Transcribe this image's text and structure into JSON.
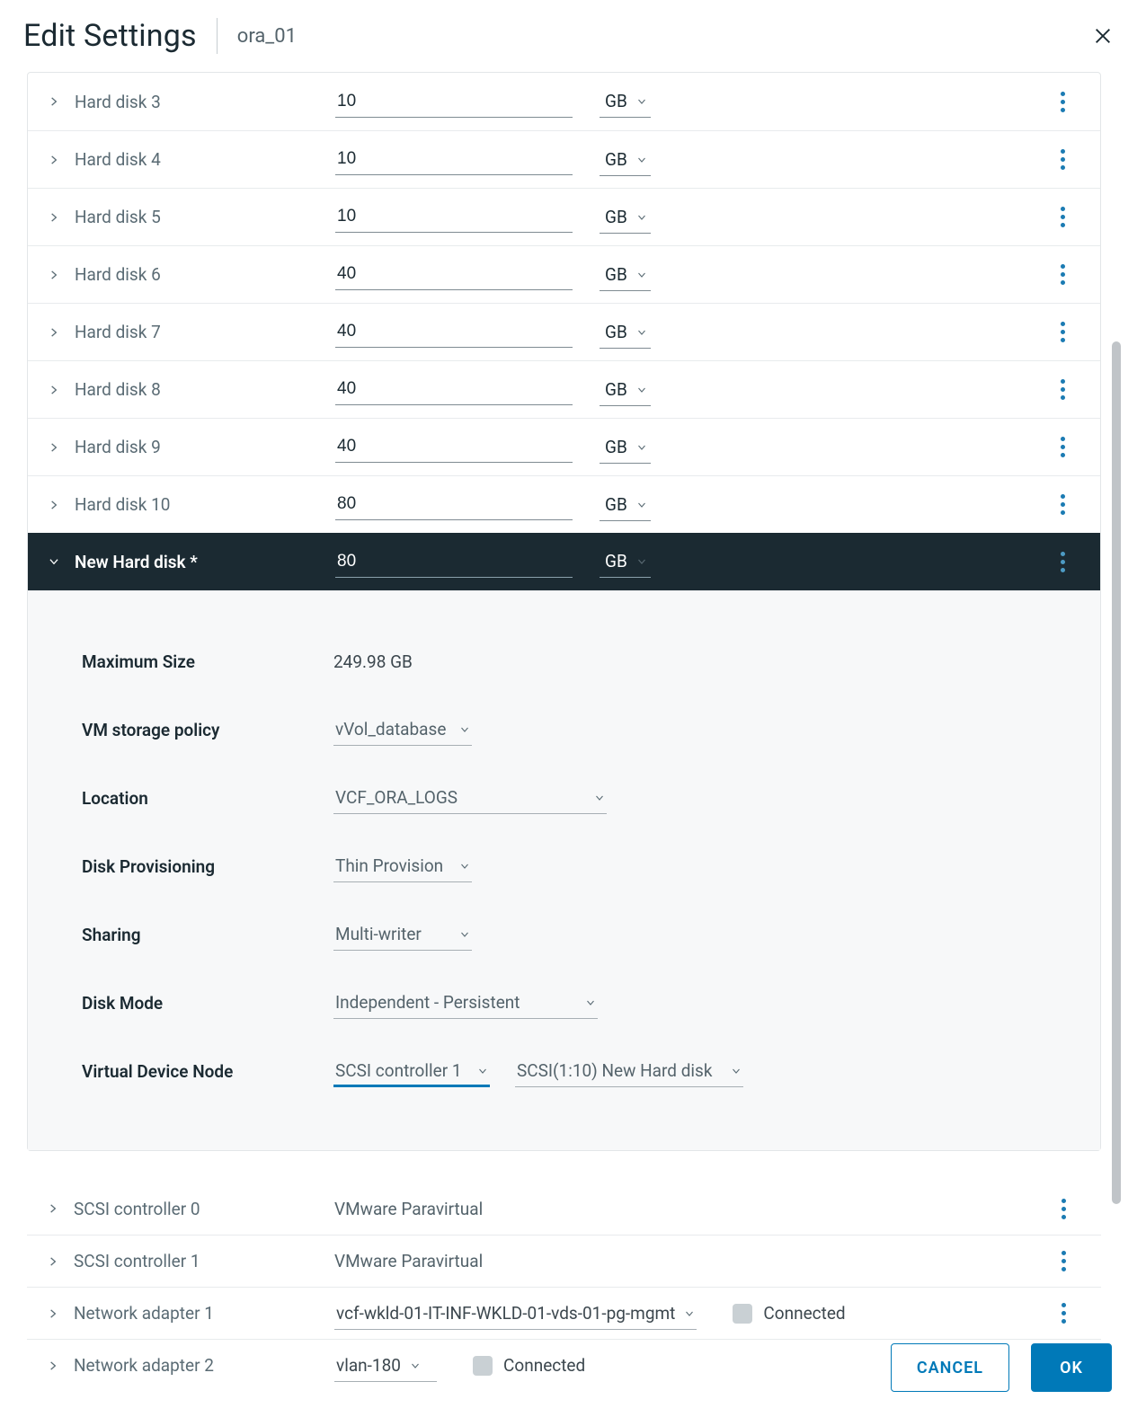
{
  "header": {
    "title": "Edit Settings",
    "subtitle": "ora_01"
  },
  "disks": [
    {
      "label": "Hard disk 3",
      "size": "10",
      "unit": "GB"
    },
    {
      "label": "Hard disk 4",
      "size": "10",
      "unit": "GB"
    },
    {
      "label": "Hard disk 5",
      "size": "10",
      "unit": "GB"
    },
    {
      "label": "Hard disk 6",
      "size": "40",
      "unit": "GB"
    },
    {
      "label": "Hard disk 7",
      "size": "40",
      "unit": "GB"
    },
    {
      "label": "Hard disk 8",
      "size": "40",
      "unit": "GB"
    },
    {
      "label": "Hard disk 9",
      "size": "40",
      "unit": "GB"
    },
    {
      "label": "Hard disk 10",
      "size": "80",
      "unit": "GB"
    }
  ],
  "newDisk": {
    "label": "New Hard disk *",
    "size": "80",
    "unit": "GB",
    "details": {
      "maxSizeLabel": "Maximum Size",
      "maxSize": "249.98 GB",
      "policyLabel": "VM storage policy",
      "policy": "vVol_database",
      "locationLabel": "Location",
      "location": "VCF_ORA_LOGS",
      "provisioningLabel": "Disk Provisioning",
      "provisioning": "Thin Provision",
      "sharingLabel": "Sharing",
      "sharing": "Multi-writer",
      "modeLabel": "Disk Mode",
      "mode": "Independent - Persistent",
      "vdnLabel": "Virtual Device Node",
      "controller": "SCSI controller 1",
      "node": "SCSI(1:10) New Hard disk"
    }
  },
  "devices": {
    "scsi0": {
      "label": "SCSI controller 0",
      "value": "VMware Paravirtual"
    },
    "scsi1": {
      "label": "SCSI controller 1",
      "value": "VMware Paravirtual"
    },
    "net1": {
      "label": "Network adapter 1",
      "network": "vcf-wkld-01-IT-INF-WKLD-01-vds-01-pg-mgmt",
      "connected": "Connected"
    },
    "net2": {
      "label": "Network adapter 2",
      "network": "vlan-180",
      "connected": "Connected"
    }
  },
  "footer": {
    "cancel": "CANCEL",
    "ok": "OK"
  }
}
